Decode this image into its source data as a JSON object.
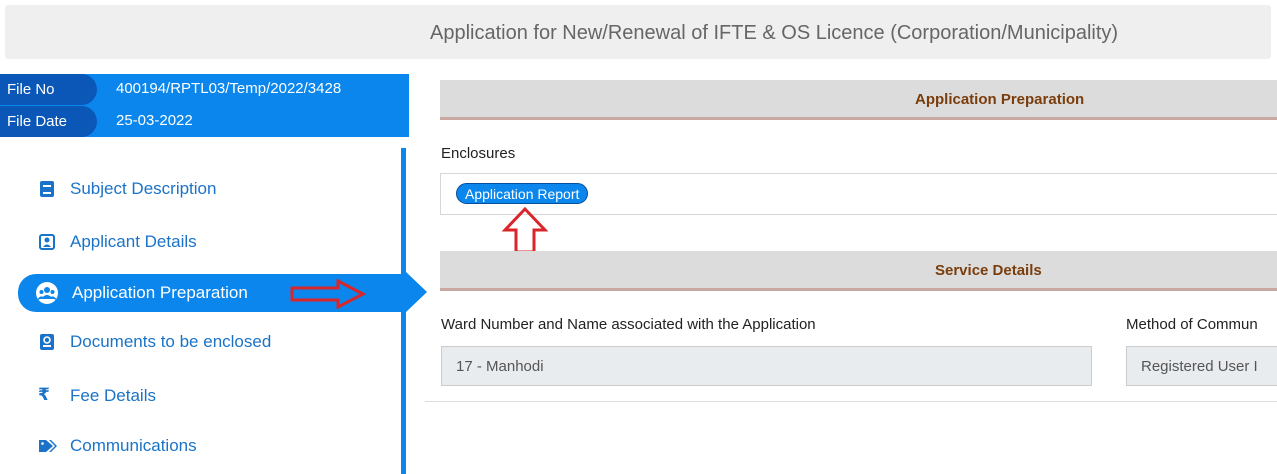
{
  "header": {
    "title": "Application for New/Renewal of IFTE & OS Licence (Corporation/Municipality)"
  },
  "file_info": {
    "file_no_label": "File No",
    "file_no_value": "400194/RPTL03/Temp/2022/3428",
    "file_date_label": "File Date",
    "file_date_value": "25-03-2022"
  },
  "sidebar": {
    "items": [
      {
        "label": "Subject Description",
        "icon": "book-icon"
      },
      {
        "label": "Applicant Details",
        "icon": "id-card-icon"
      },
      {
        "label": "Application Preparation",
        "icon": "user-group-icon",
        "active": true
      },
      {
        "label": "Documents to be enclosed",
        "icon": "document-icon"
      },
      {
        "label": "Fee Details",
        "icon": "rupee-icon"
      },
      {
        "label": "Communications",
        "icon": "tag-icon"
      }
    ]
  },
  "main": {
    "application_preparation": {
      "header": "Application Preparation",
      "enclosures_label": "Enclosures",
      "enclosure_chip": "Application Report"
    },
    "service_details": {
      "header": "Service Details",
      "ward_label": "Ward Number and Name associated with the Application",
      "ward_value": "17 - Manhodi",
      "method_label": "Method of Commun",
      "method_value": "Registered User I"
    }
  },
  "annotations": {
    "arrow_color": "#d9262b"
  },
  "colors": {
    "accent": "#0a86ec",
    "dark_accent": "#0b57b7",
    "section_title": "#7a3d0c"
  }
}
